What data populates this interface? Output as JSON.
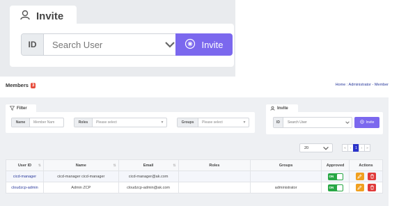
{
  "zoom_invite": {
    "tab_label": "Invite",
    "id_label": "ID",
    "search_placeholder": "Search User",
    "button_label": "Invite"
  },
  "header": {
    "title": "Members",
    "badge_count": "3",
    "breadcrumb": "Home : Administrator - Member"
  },
  "filter": {
    "tab_label": "Filter",
    "name_label": "Name",
    "name_placeholder": "Member Nam",
    "roles_label": "Roles",
    "roles_placeholder": "Please select",
    "groups_label": "Groups",
    "groups_placeholder": "Please select"
  },
  "invite": {
    "tab_label": "Invite",
    "id_label": "ID",
    "search_placeholder": "Search User",
    "button_label": "Invite"
  },
  "pagination": {
    "page_size": "20",
    "first": "«",
    "prev": "‹",
    "current": "1",
    "next": "›",
    "last": "»"
  },
  "table": {
    "columns": [
      "User ID",
      "Name",
      "Email",
      "Roles",
      "Groups",
      "Approved",
      "Actions"
    ],
    "rows": [
      {
        "user_id": "cicd-manager",
        "name": "cicd-manager cicd-manager",
        "email": "cicd-manager@ak.com",
        "roles": "",
        "groups": "",
        "approved": "ON"
      },
      {
        "user_id": "cloudzcp-admin",
        "name": "Admin ZCP",
        "email": "cloudzcp-admin@ak.com",
        "roles": "",
        "groups": "administrator",
        "approved": "ON"
      }
    ]
  },
  "colors": {
    "accent": "#7b68ee",
    "badge": "#e74c3c",
    "toggle_on": "#28a745",
    "edit": "#f0a020",
    "delete": "#e03a3a",
    "page_active": "#2b33c9"
  },
  "icons": [
    "user-icon",
    "chevron-down-icon",
    "plus-circle-icon",
    "filter-icon",
    "sort-icon",
    "pencil-icon",
    "trash-icon"
  ]
}
